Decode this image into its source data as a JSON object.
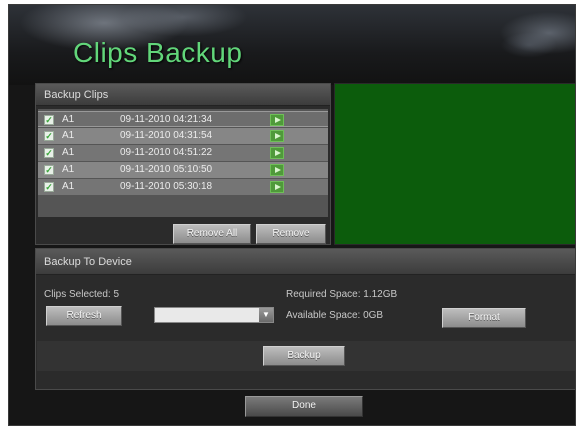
{
  "window": {
    "title": "Clips Backup"
  },
  "clips_panel": {
    "header": "Backup Clips",
    "rows": [
      {
        "camera": "A1",
        "time": "09-11-2010 04:21:34"
      },
      {
        "camera": "A1",
        "time": "09-11-2010 04:31:54"
      },
      {
        "camera": "A1",
        "time": "09-11-2010 04:51:22"
      },
      {
        "camera": "A1",
        "time": "09-11-2010 05:10:50"
      },
      {
        "camera": "A1",
        "time": "09-11-2010 05:30:18"
      }
    ],
    "remove_all_label": "Remove All",
    "remove_label": "Remove"
  },
  "device_panel": {
    "header": "Backup To Device",
    "clips_selected": "Clips Selected: 5",
    "required_space": "Required Space: 1.12GB",
    "available_space": "Available Space: 0GB",
    "refresh_label": "Refresh",
    "device_select_value": "",
    "format_label": "Format",
    "backup_label": "Backup"
  },
  "footer": {
    "done_label": "Done"
  },
  "colors": {
    "title_green": "#62d67a",
    "preview_green": "#0c5c0c",
    "play_green": "#4f9a3a"
  },
  "icons": {
    "row_check": "check-icon",
    "row_play": "play-icon",
    "dropdown": "chevron-down-icon"
  }
}
